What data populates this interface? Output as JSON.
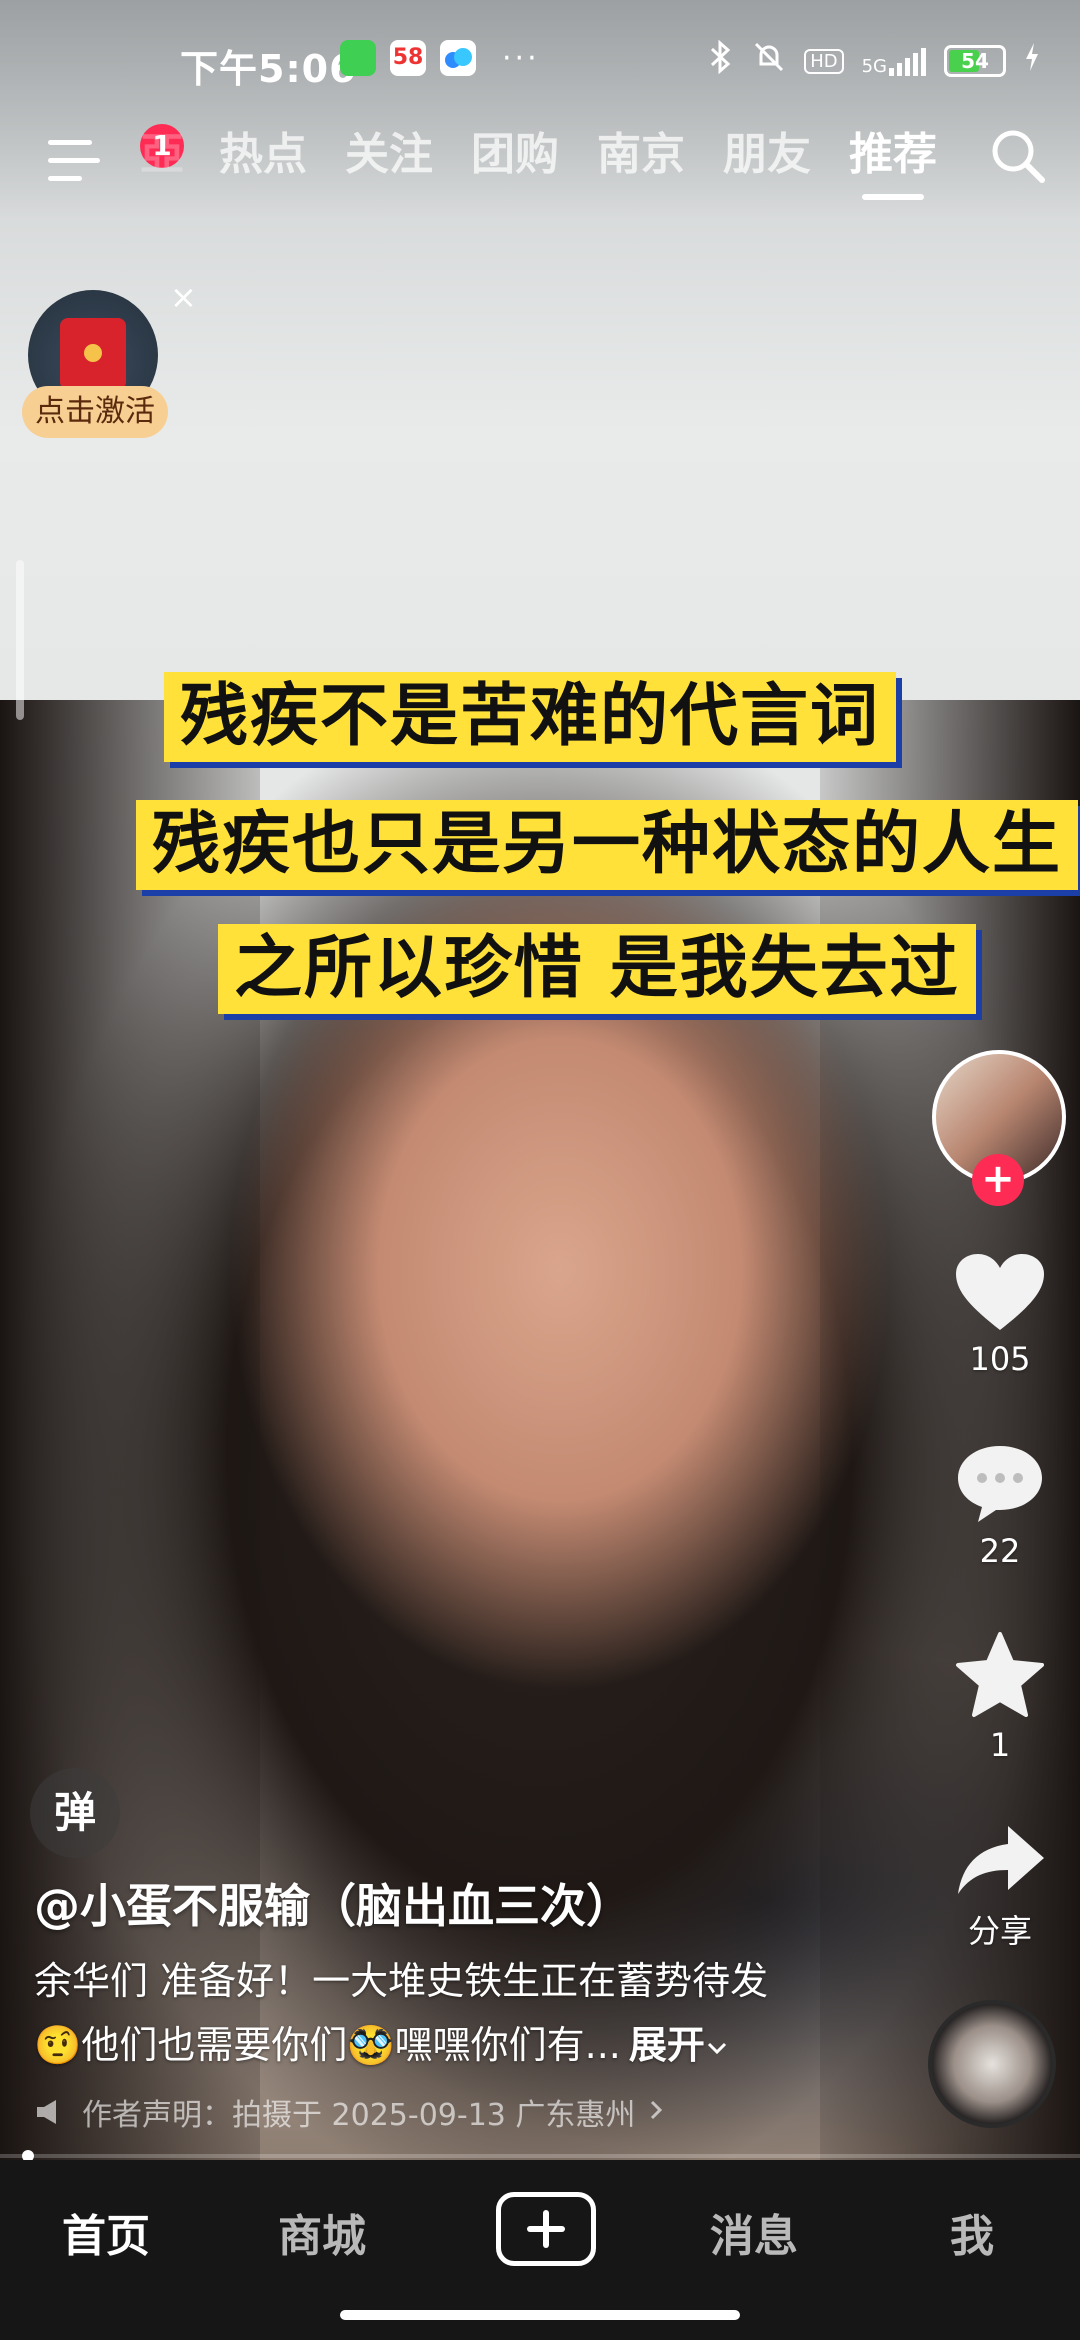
{
  "status_bar": {
    "time": "下午5:06",
    "app_58_label": "58",
    "hd_label": "HD",
    "network": "5G",
    "battery": "54"
  },
  "top_nav": {
    "menu_badge": "1",
    "partial_tab": "亞",
    "tabs": [
      {
        "label": "热点"
      },
      {
        "label": "关注"
      },
      {
        "label": "团购"
      },
      {
        "label": "南京"
      },
      {
        "label": "朋友"
      },
      {
        "label": "推荐"
      }
    ]
  },
  "red_packet": {
    "label": "点击激活",
    "close": "×"
  },
  "captions": [
    "残疾不是苦难的代言词",
    "残疾也只是另一种状态的人生",
    "之所以珍惜 是我失去过"
  ],
  "right_rail": {
    "like_count": "105",
    "comment_count": "22",
    "favorite_count": "1",
    "share_label": "分享",
    "follow_label": "+"
  },
  "post": {
    "danmu_label": "弹",
    "author": "@小蛋不服输（脑出血三次）",
    "desc_line_1": "余华们 准备好！一大堆史铁生正在蓄势待发",
    "desc_line_2": "🤨他们也需要你们🥸嘿嘿你们有...",
    "expand_label": "展开",
    "statement": "作者声明：拍摄于 2025-09-13 广东惠州"
  },
  "bottom_tabs": {
    "home": "首页",
    "mall": "商城",
    "messages": "消息",
    "me": "我"
  },
  "colors": {
    "accent": "#fe2c55",
    "caption_bg": "#ffe13a",
    "caption_shadow": "#1b3fa6"
  }
}
